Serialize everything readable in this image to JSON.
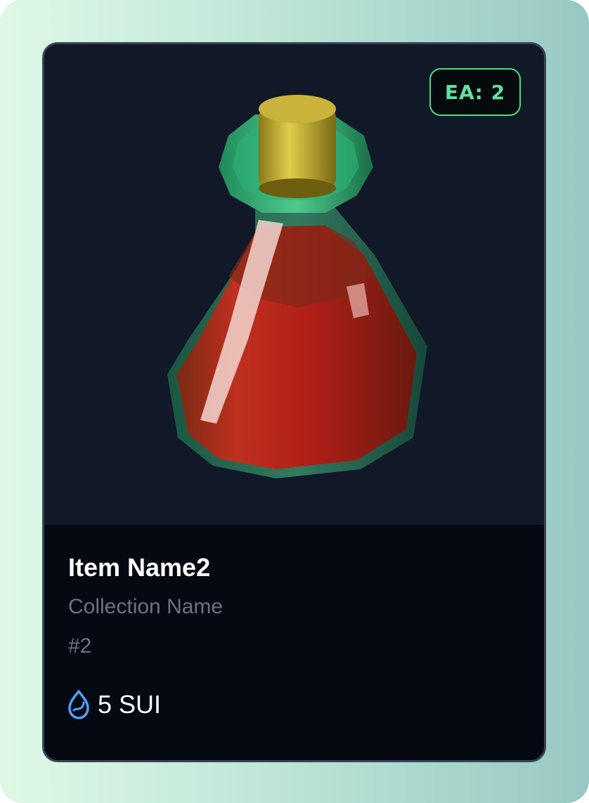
{
  "badge": {
    "label": "EA",
    "value": "2"
  },
  "item": {
    "name": "Item Name2",
    "collection": "Collection Name",
    "number": "#2"
  },
  "price": {
    "amount": "5 SUI",
    "icon": "sui-drop-icon"
  },
  "image": {
    "subject": "potion-bottle-icon"
  },
  "colors": {
    "accent": "#4ade80",
    "sui_blue": "#4da2ff"
  }
}
